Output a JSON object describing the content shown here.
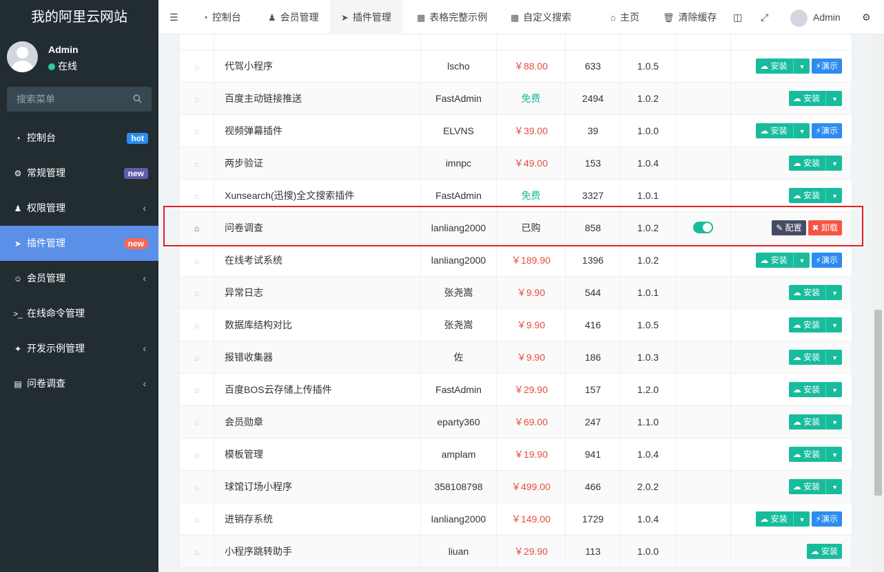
{
  "sidebar": {
    "logo": "我的阿里云网站",
    "user": "Admin",
    "status": "在线",
    "search_placeholder": "搜索菜单",
    "menu": [
      {
        "label": "控制台",
        "icon": "dashboard-icon",
        "badge": "hot"
      },
      {
        "label": "常规管理",
        "icon": "cogs-icon",
        "badge": "new"
      },
      {
        "label": "权限管理",
        "icon": "group-icon",
        "chevron": "‹"
      },
      {
        "label": "插件管理",
        "icon": "rocket-icon",
        "badge": "new"
      },
      {
        "label": "会员管理",
        "icon": "user-circle-icon",
        "chevron": "‹"
      },
      {
        "label": "在线命令管理",
        "icon": "terminal-icon"
      },
      {
        "label": "开发示例管理",
        "icon": "magic-icon",
        "chevron": "‹"
      },
      {
        "label": "问卷调查",
        "icon": "file-icon",
        "chevron": "‹"
      }
    ]
  },
  "topbar": {
    "tabs": [
      {
        "label": "控制台",
        "icon": "dashboard-icon"
      },
      {
        "label": "会员管理",
        "icon": "user-icon"
      },
      {
        "label": "插件管理",
        "icon": "rocket-icon"
      },
      {
        "label": "表格完整示例",
        "icon": "table-icon"
      },
      {
        "label": "自定义搜索",
        "icon": "table-icon"
      }
    ],
    "home": "主页",
    "clear_cache": "清除缓存",
    "admin": "Admin"
  },
  "buttons": {
    "install": "安装",
    "demo": "演示",
    "config": "配置",
    "uninstall": "卸载"
  },
  "rows": [
    {
      "name": "代驾小程序",
      "author": "lscho",
      "price": "￥88.00",
      "downloads": "633",
      "version": "1.0.5",
      "demo": true
    },
    {
      "name": "百度主动链接推送",
      "author": "FastAdmin",
      "price": "免费",
      "downloads": "2494",
      "version": "1.0.2"
    },
    {
      "name": "视频弹幕插件",
      "author": "ELVNS",
      "price": "￥39.00",
      "downloads": "39",
      "version": "1.0.0",
      "demo": true
    },
    {
      "name": "两步验证",
      "author": "imnpc",
      "price": "￥49.00",
      "downloads": "153",
      "version": "1.0.4"
    },
    {
      "name": "Xunsearch(迅搜)全文搜索插件",
      "author": "FastAdmin",
      "price": "免费",
      "downloads": "3327",
      "version": "1.0.1"
    },
    {
      "name": "问卷调查",
      "author": "lanliang2000",
      "price": "已购",
      "downloads": "858",
      "version": "1.0.2",
      "installed": true
    },
    {
      "name": "在线考试系统",
      "author": "lanliang2000",
      "price": "￥189.90",
      "downloads": "1396",
      "version": "1.0.2",
      "demo": true
    },
    {
      "name": "异常日志",
      "author": "张尧嵩",
      "price": "￥9.90",
      "downloads": "544",
      "version": "1.0.1"
    },
    {
      "name": "数据库结构对比",
      "author": "张尧嵩",
      "price": "￥9.90",
      "downloads": "416",
      "version": "1.0.5"
    },
    {
      "name": "报错收集器",
      "author": "佐",
      "price": "￥9.90",
      "downloads": "186",
      "version": "1.0.3"
    },
    {
      "name": "百度BOS云存储上传插件",
      "author": "FastAdmin",
      "price": "￥29.90",
      "downloads": "157",
      "version": "1.2.0"
    },
    {
      "name": "会员勋章",
      "author": "eparty360",
      "price": "￥69.00",
      "downloads": "247",
      "version": "1.1.0"
    },
    {
      "name": "模板管理",
      "author": "amplam",
      "price": "￥19.90",
      "downloads": "941",
      "version": "1.0.4"
    },
    {
      "name": "球馆订场小程序",
      "author": "358108798",
      "price": "￥499.00",
      "downloads": "466",
      "version": "2.0.2"
    },
    {
      "name": "进销存系统",
      "author": "lanliang2000",
      "price": "￥149.00",
      "downloads": "1729",
      "version": "1.0.4",
      "demo": true
    },
    {
      "name": "小程序跳转助手",
      "author": "liuan",
      "price": "￥29.90",
      "downloads": "113",
      "version": "1.0.0",
      "nocaret": true
    }
  ]
}
